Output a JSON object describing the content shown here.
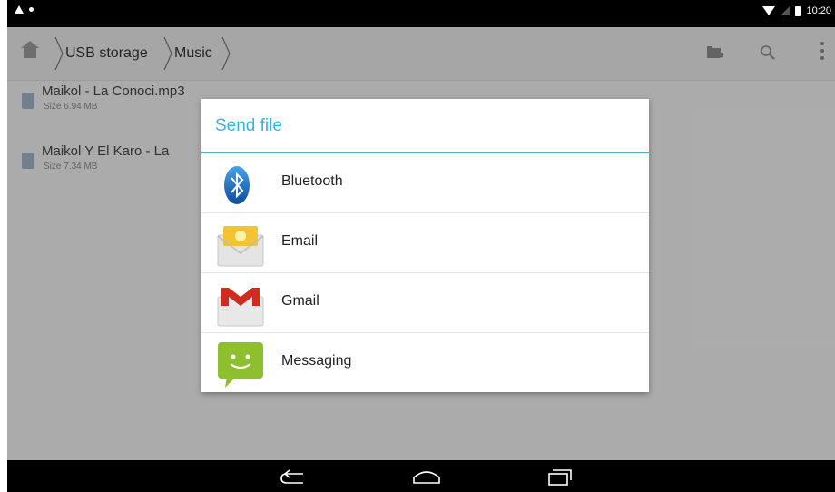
{
  "status_bar": {
    "time": "10:20",
    "icons": [
      "notification-triangle-icon",
      "notification-dot-icon",
      "wifi-icon",
      "signal-icon",
      "battery-icon"
    ]
  },
  "action_bar": {
    "breadcrumbs": [
      "USB storage",
      "Music"
    ],
    "icons": [
      "home-icon",
      "folder-icon",
      "search-icon",
      "overflow-menu-icon"
    ]
  },
  "files": [
    {
      "name": "Maikol - La Conoci.mp3",
      "size": "Size 6.94 MB"
    },
    {
      "name": "Maikol Y El Karo - La",
      "size": "Size 7.34 MB"
    }
  ],
  "dialog": {
    "title": "Send file",
    "accent_color": "#33b5e5",
    "options": [
      {
        "label": "Bluetooth",
        "icon": "bluetooth-icon"
      },
      {
        "label": "Email",
        "icon": "email-icon"
      },
      {
        "label": "Gmail",
        "icon": "gmail-icon"
      },
      {
        "label": "Messaging",
        "icon": "messaging-icon"
      }
    ]
  },
  "nav_bar": {
    "buttons": [
      "back-icon",
      "home-nav-icon",
      "recent-apps-icon"
    ]
  }
}
